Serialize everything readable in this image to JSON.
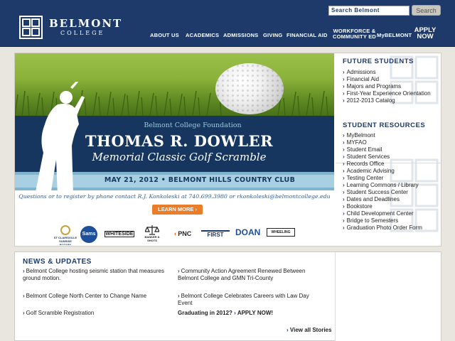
{
  "header": {
    "logo_name": "BELMONT",
    "logo_sub": "COLLEGE",
    "search_placeholder": "Search Belmont",
    "search_button": "Search",
    "nav": [
      {
        "label": "ABOUT US"
      },
      {
        "label": "ACADEMICS"
      },
      {
        "label": "ADMISSIONS"
      },
      {
        "label": "GIVING"
      },
      {
        "label": "FINANCIAL AID"
      },
      {
        "label_line1": "WORKFORCE &",
        "label_line2": "COMMUNITY ED"
      },
      {
        "label": "MyBELMONT"
      }
    ],
    "apply_line1": "APPLY",
    "apply_line2": "NOW"
  },
  "banner": {
    "foundation": "Belmont College Foundation",
    "name": "THOMAS R. DOWLER",
    "event": "Memorial Classic Golf Scramble",
    "date_line": "MAY 21, 2012  •  BELMONT HILLS COUNTRY CLUB",
    "contact": "Questions or to register by phone contact R.J. Konkoleski at 740.699.3980 or rkonkoleski@belmontcollege.edu",
    "learn_more": "LEARN MORE ›",
    "sponsors": [
      "ST CLAIRSVILLE SUNRISE ROTARY",
      "Sams",
      "WHITESIDE",
      "BANKER & SHOTS",
      "PNC",
      "FIRST",
      "DOAN",
      "WHEELING"
    ]
  },
  "sidebar": {
    "future_title": "FUTURE STUDENTS",
    "future_items": [
      "Admissions",
      "Financial Aid",
      "Majors and Programs",
      "First-Year Experience Orientation",
      "2012-2013 Catalog"
    ],
    "resources_title": "STUDENT RESOURCES",
    "resources_items": [
      "MyBelmont",
      "MYFAO",
      "Student Email",
      "Student Services",
      "Records Office",
      "Academic Advising",
      "Testing Center",
      "Learning Commons / Library",
      "Student Success Center",
      "Dates and Deadlines",
      "Bookstore",
      "Child Development Center",
      "Bridge to Semesters",
      "Graduation Photo Order Form"
    ]
  },
  "news": {
    "title": "NEWS & UPDATES",
    "items": [
      "Belmont College hosting seismic station that measures ground motion.",
      "Community Action Agreement Renewed Between Belmont College and GMN Tri-County",
      "Belmont College North Center to Change Name",
      "Belmont College Celebrates Careers with Law Day Event",
      "Golf Scramble Registration",
      "Graduating in 2012?",
      "APPLY NOW!"
    ],
    "view_all": "View all Stories"
  }
}
